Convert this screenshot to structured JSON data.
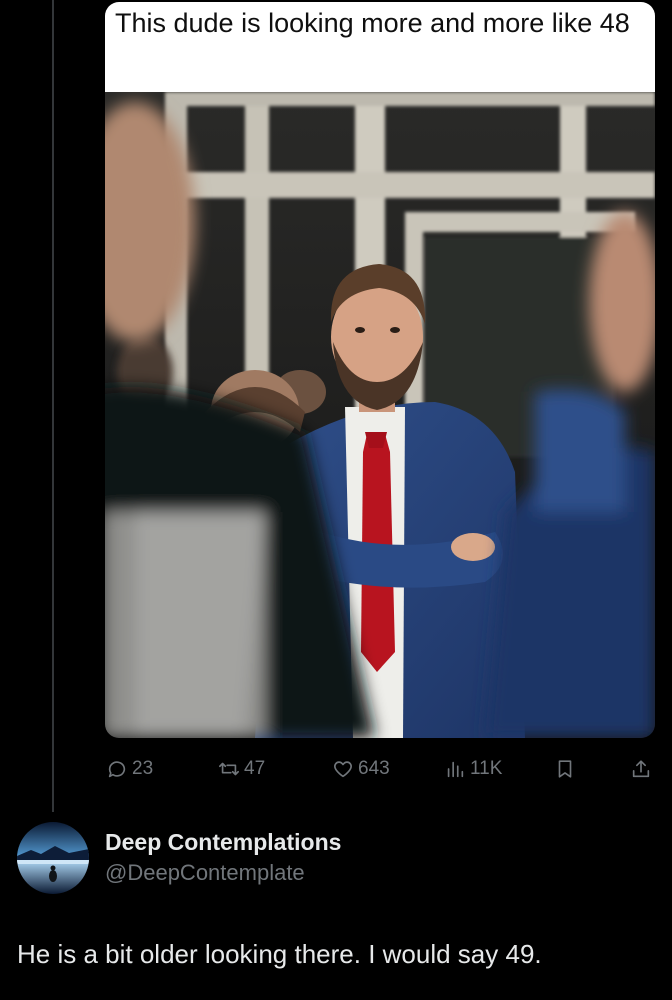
{
  "post": {
    "meme_caption": "This dude is looking more and more like 48",
    "stats": {
      "replies": "23",
      "reposts": "47",
      "likes": "643",
      "views": "11K"
    },
    "icons": {
      "reply": "reply-icon",
      "repost": "repost-icon",
      "like": "heart-icon",
      "views": "views-icon",
      "bookmark": "bookmark-icon",
      "share": "share-icon"
    }
  },
  "reply": {
    "display_name": "Deep Contemplations",
    "handle": "@DeepContemplate",
    "text": "He is a bit older looking there.  I would say 49."
  },
  "colors": {
    "background": "#000000",
    "primary_text": "#e7e9ea",
    "secondary_text": "#71767b",
    "thread_line": "#333639"
  }
}
